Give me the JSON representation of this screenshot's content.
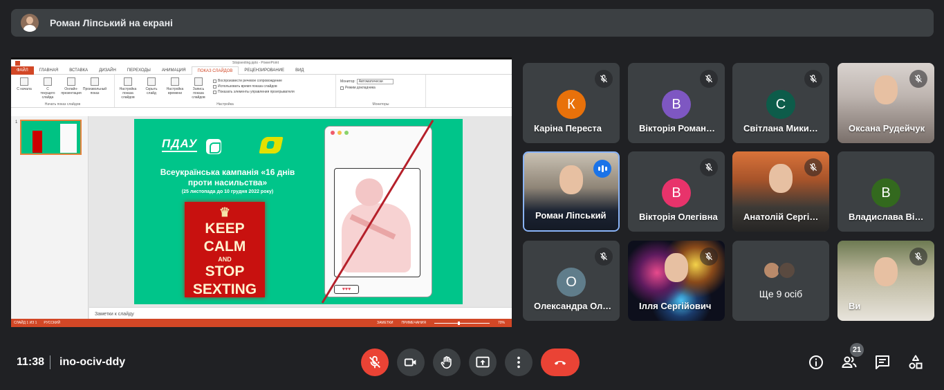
{
  "presenter_bar": {
    "text": "Роман Ліпський на екрані"
  },
  "ppt": {
    "title": "Stopsexting.pptx - PowerPoint",
    "tabs": [
      "ФАЙЛ",
      "ГЛАВНАЯ",
      "ВСТАВКА",
      "ДИЗАЙН",
      "ПЕРЕХОДЫ",
      "АНИМАЦИЯ",
      "ПОКАЗ СЛАЙДОВ",
      "РЕЦЕНЗИРОВАНИЕ",
      "ВИД"
    ],
    "ribbon": {
      "btn_start": "С начала",
      "btn_current": "С текущего слайда",
      "btn_online": "Онлайн-презентация",
      "btn_custom": "Произвольный показ",
      "group_start": "Начать показ слайдов",
      "btn_setup": "Настройка показа слайдов",
      "btn_hide": "Скрыть слайд",
      "btn_timing": "Настройка времени",
      "btn_record": "Запись показа слайдов",
      "chk_narration": "Воспроизвести речевое сопровождение",
      "chk_timings": "Использовать время показа слайдов",
      "chk_controls": "Показать элементы управления проигрывателя",
      "group_setup": "Настройка",
      "monitor_label": "Монитор:",
      "monitor_value": "Автоматически",
      "chk_presenter": "Режим докладчика",
      "group_monitors": "Мониторы"
    },
    "thumb_num": "1",
    "notes": "Заметки к слайду",
    "status": {
      "slide": "СЛАЙД 1 ИЗ 1",
      "lang": "РУССКИЙ",
      "notes": "ЗАМЕТКИ",
      "comments": "ПРИМЕЧАНИЯ",
      "zoom": "70%"
    },
    "slide": {
      "logo": "ПДАУ",
      "heading": "Всеукраїнська кампанія «16 днів проти насильства»",
      "dates": "(25 листопада до 10 грудня 2022 року)",
      "keep": "KEEP",
      "calm": "CALM",
      "and": "AND",
      "stop": "STOP",
      "sexting": "SEXTING",
      "hearts": "♥♥♥"
    }
  },
  "participants": [
    {
      "name": "Каріна Переста",
      "initial": "К",
      "color": "#e8710a",
      "muted": true
    },
    {
      "name": "Вікторія Романюк",
      "initial": "В",
      "color": "#7e57c2",
      "muted": true
    },
    {
      "name": "Світлана Микитюк",
      "initial": "С",
      "color": "#0d5c4a",
      "muted": true
    },
    {
      "name": "Оксана Рудейчук",
      "video": true,
      "muted": true
    },
    {
      "name": "Роман Ліпський",
      "video": true,
      "speaking": true
    },
    {
      "name": "Вікторія Олегівна",
      "initial": "В",
      "color": "#e8336b",
      "muted": true
    },
    {
      "name": "Анатолій Сергійович",
      "video": true,
      "muted": true
    },
    {
      "name": "Владислава Вікторівна",
      "initial": "В",
      "color": "#33691e",
      "muted": false
    },
    {
      "name": "Олександра Олександрівна",
      "initial": "О",
      "color": "#607d8b",
      "muted": true
    },
    {
      "name": "Ілля Сергійович",
      "video": true,
      "muted": true
    },
    {
      "name": "Ще 9 осіб"
    },
    {
      "name": "Ви",
      "video": true,
      "muted": true
    }
  ],
  "bottom": {
    "time": "11:38",
    "meeting_code": "ino-ociv-ddy",
    "participant_count": "21"
  }
}
